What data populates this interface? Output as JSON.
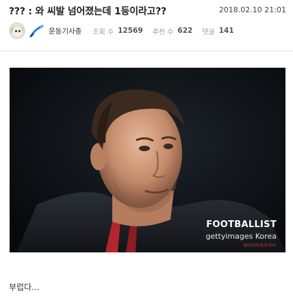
{
  "post": {
    "title": "??? : 와 씨발 넘어졌는데 1등이라고??",
    "date": "2018.02.10 21:01",
    "author": {
      "nickname": "운동기사충",
      "avatar_icon": "puppy-avatar-icon",
      "level_icon": "brush-level-icon"
    },
    "stats": [
      {
        "label": "조회 수",
        "value": "12569"
      },
      {
        "label": "추천 수",
        "value": "622"
      },
      {
        "label": "댓글",
        "value": "141"
      }
    ],
    "image": {
      "watermark_brand": "FOOTBALLIST",
      "watermark_credit": "gettyimages Korea",
      "watermark_small": "게티이미지코리아"
    },
    "body": "부럽다..."
  },
  "colors": {
    "image_background": "#0b0d10",
    "accent_blue": "#2f7fd0"
  }
}
